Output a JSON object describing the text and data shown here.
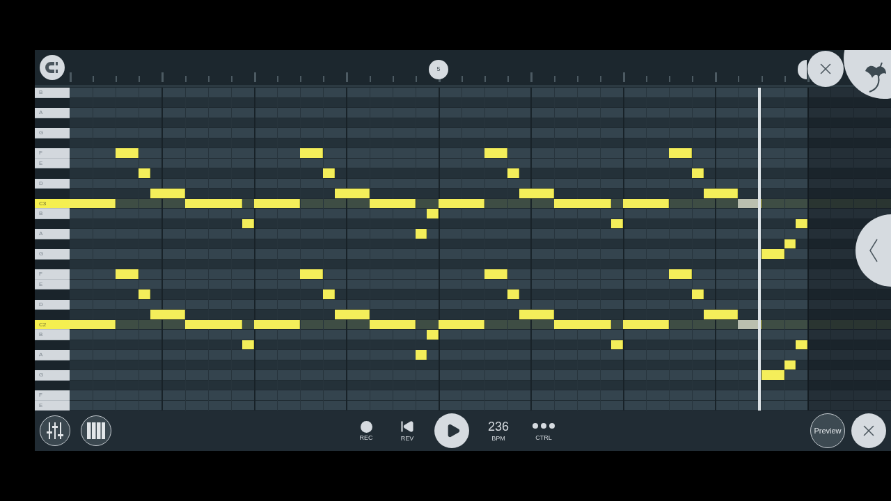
{
  "ruler": {
    "marker": {
      "label": "5"
    }
  },
  "rows": [
    {
      "kind": "white",
      "label": "B",
      "root": false
    },
    {
      "kind": "black",
      "root": false
    },
    {
      "kind": "white",
      "label": "A",
      "root": false
    },
    {
      "kind": "black",
      "root": false
    },
    {
      "kind": "white",
      "label": "G",
      "root": false
    },
    {
      "kind": "black",
      "root": false
    },
    {
      "kind": "white",
      "label": "F",
      "root": false
    },
    {
      "kind": "white",
      "label": "E",
      "root": false
    },
    {
      "kind": "black",
      "root": false
    },
    {
      "kind": "white",
      "label": "D",
      "root": false
    },
    {
      "kind": "black",
      "root": false
    },
    {
      "kind": "white",
      "label": "C3",
      "root": true
    },
    {
      "kind": "white",
      "label": "B",
      "root": false
    },
    {
      "kind": "black",
      "root": false
    },
    {
      "kind": "white",
      "label": "A",
      "root": false
    },
    {
      "kind": "black",
      "root": false
    },
    {
      "kind": "white",
      "label": "G",
      "root": false
    },
    {
      "kind": "black",
      "root": false
    },
    {
      "kind": "white",
      "label": "F",
      "root": false
    },
    {
      "kind": "white",
      "label": "E",
      "root": false
    },
    {
      "kind": "black",
      "root": false
    },
    {
      "kind": "white",
      "label": "D",
      "root": false
    },
    {
      "kind": "black",
      "root": false
    },
    {
      "kind": "white",
      "label": "C2",
      "root": true
    },
    {
      "kind": "white",
      "label": "B",
      "root": false
    },
    {
      "kind": "black",
      "root": false
    },
    {
      "kind": "white",
      "label": "A",
      "root": false
    },
    {
      "kind": "black",
      "root": false
    },
    {
      "kind": "white",
      "label": "G",
      "root": false
    },
    {
      "kind": "black",
      "root": false
    },
    {
      "kind": "white",
      "label": "F",
      "root": false
    },
    {
      "kind": "white",
      "label": "E",
      "root": false
    }
  ],
  "transport": [
    {
      "kind": "record",
      "label": "REC"
    },
    {
      "kind": "rewind",
      "label": "REV"
    },
    {
      "kind": "play"
    },
    {
      "kind": "tempo",
      "value": "236",
      "label": "BPM"
    },
    {
      "kind": "more",
      "label": "CTRL"
    }
  ],
  "preview": {
    "label": "Preview"
  }
}
